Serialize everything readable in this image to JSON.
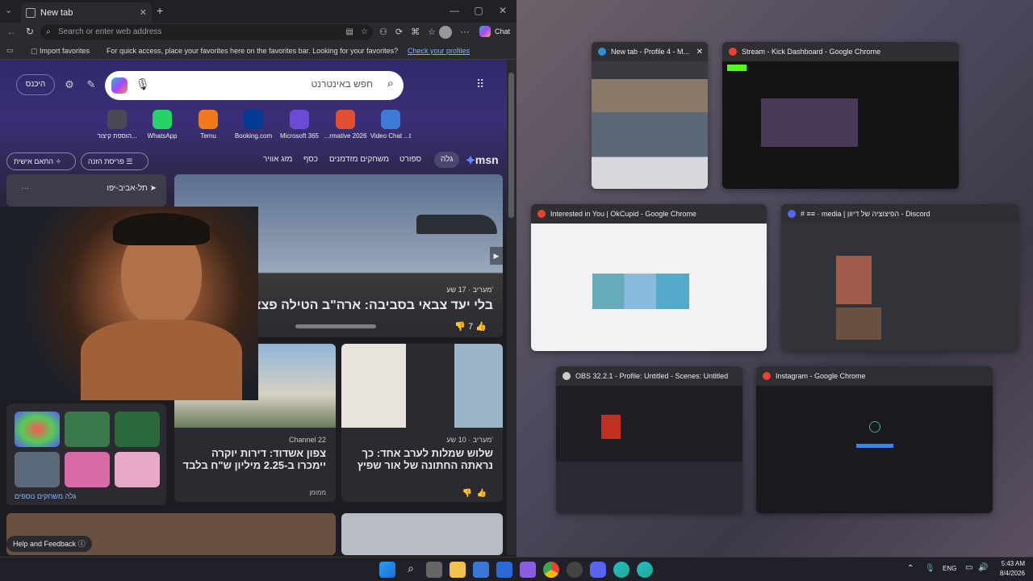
{
  "browser": {
    "tab_title": "New tab",
    "address_placeholder": "Search or enter web address",
    "chat_label": "Chat",
    "favbar": {
      "import_label": "Import favorites",
      "message": "For quick access, place your favorites here on the favorites bar. Looking for your favorites?",
      "link": "Check your profiles"
    },
    "home_button": "היכנס",
    "search_placeholder": "חפש באינטרנט",
    "quicklinks": [
      {
        "label": "הוספת קיצור...",
        "color": "#4a4a55",
        "icon": "plus-icon"
      },
      {
        "label": "WhatsApp",
        "color": "#25d366",
        "icon": "whatsapp-icon"
      },
      {
        "label": "Temu",
        "color": "#f07a1a",
        "icon": "temu-icon"
      },
      {
        "label": "Booking.com",
        "color": "#003b95",
        "icon": "booking-icon"
      },
      {
        "label": "Microsoft 365",
        "color": "#6a4bd6",
        "icon": "m365-icon"
      },
      {
        "label": "...rmative 2026",
        "color": "#e05030",
        "icon": "doc-icon"
      },
      {
        "label": "Video Chat ...t",
        "color": "#3b7bd6",
        "icon": "video-icon"
      }
    ],
    "msn": {
      "brand": "msn",
      "nav": [
        "גלה",
        "ספורט",
        "משחקים מזדמנים",
        "כסף",
        "מזג אוויר"
      ],
      "layout_button": "פריסת הזנה",
      "personalize_button": "התאם אישית"
    },
    "weather_location": "תל-אביב-יפו",
    "hero": {
      "source": "מעריב · 17 שע'",
      "headline": "בלי יעד צבאי בסביבה: ארה\"ב הטילה פצצות",
      "likes": "7"
    },
    "card_left": {
      "source": "Channel 22",
      "headline": "צפון אשדוד: דירות יוקרה יימכרו ב-2.25 מיליון ש\"ח בלבד",
      "tag": "ממומן"
    },
    "card_right": {
      "source": "מעריב · 10 שע'",
      "headline": "שלוש שמלות לערב אחד: כך נראתה החתונה של אור שפיץ"
    },
    "games_link": "גלה משחקים נוספים",
    "help": "Help and Feedback"
  },
  "windows": [
    {
      "title": "New tab - Profile 4 - M...",
      "icon_color": "#2a8fd6",
      "bg": "#3a3a40"
    },
    {
      "title": "Stream - Kick Dashboard - Google Chrome",
      "icon_color": "#e94235",
      "bg": "#141414"
    },
    {
      "title": "Interested in You | OkCupid - Google Chrome",
      "icon_color": "#e94235",
      "bg": "#f2f2f5"
    },
    {
      "title": "# ≡≡ · media | הפיצוציה של דיוון - Discord",
      "icon_color": "#5865f2",
      "bg": "#313338"
    },
    {
      "title": "OBS 32.2.1 - Profile: Untitled - Scenes: Untitled",
      "icon_color": "#cccccc",
      "bg": "#1e1e24"
    },
    {
      "title": "Instagram - Google Chrome",
      "icon_color": "#e94235",
      "bg": "#1a1a1e"
    }
  ],
  "tray": {
    "lang": "ENG",
    "time": "5:43 AM",
    "date": "8/4/2026"
  }
}
